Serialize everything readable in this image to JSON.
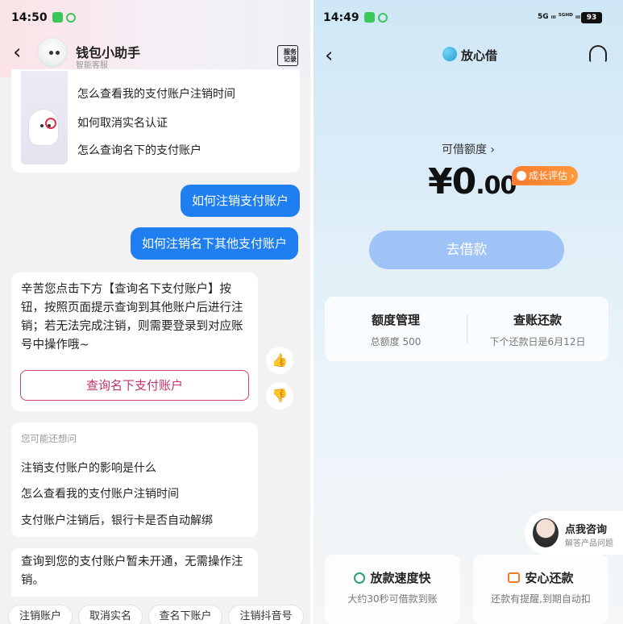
{
  "left": {
    "status_time": "14:50",
    "back": "‹",
    "title": "钱包小助手",
    "subtitle": "智能客服",
    "service_record": "服务记录",
    "suggest_items": [
      "怎么查看我的支付账户注销时间",
      "如何取消实名认证",
      "怎么查询名下的支付账户"
    ],
    "user_bubbles": [
      "如何注销支付账户",
      "如何注销名下其他支付账户"
    ],
    "reply_text": "辛苦您点击下方【查询名下支付账户】按钮，按照页面提示查询到其他账户后进行注销；若无法完成注销，则需要登录到对应账号中操作哦~",
    "reply_button": "查询名下支付账户",
    "thumb_up": "👍",
    "thumb_down": "👎",
    "maybe_header": "您可能还想问",
    "maybe_items": [
      "注销支付账户的影响是什么",
      "怎么查看我的支付账户注销时间",
      "支付账户注销后，银行卡是否自动解绑"
    ],
    "last_reply": "查询到您的支付账户暂未开通，无需操作注销。",
    "chips": [
      "注销账户",
      "取消实名",
      "查名下账户",
      "注销抖音号"
    ],
    "icons": {
      "back": "back-icon",
      "service": "service-record-icon",
      "thumb_up": "thumb-up-icon",
      "thumb_down": "thumb-down-icon"
    }
  },
  "right": {
    "status_time": "14:49",
    "signal": "5G ᵢₗₗ ⁵ᴳᴴᴰ ᵢₗₗ",
    "battery": "93",
    "back": "‹",
    "title": "放心借",
    "credit_label": "可借额度 ›",
    "amount_main": "¥0",
    "amount_dec": ".00",
    "growth": "成长评估 ›",
    "borrow_button": "去借款",
    "quota_title": "额度管理",
    "quota_sub": "总额度 500",
    "bill_title": "查账还款",
    "bill_sub": "下个还款日是6月12日",
    "consult_title": "点我咨询",
    "consult_sub": "解答产品问题",
    "feature1_title": "放款速度快",
    "feature1_sub": "大约30秒可借款到账",
    "feature2_title": "安心还款",
    "feature2_sub": "还款有提醒,到期自动扣",
    "colors": {
      "accent": "#1f7ff0",
      "borrow_button": "#9fc3f6",
      "growth": "#ff7a2e",
      "reply_button": "#c23366"
    }
  }
}
